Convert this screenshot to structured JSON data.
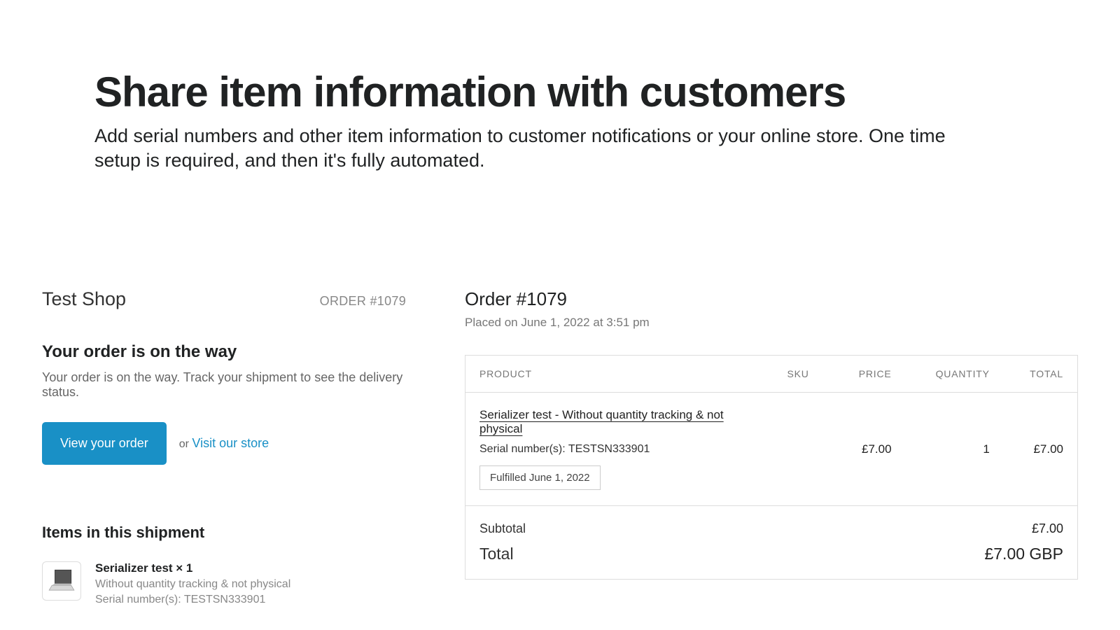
{
  "header": {
    "title": "Share item information with customers",
    "subtitle": "Add serial numbers and other item information to customer notifications or your online store. One time setup is required, and then it's fully automated."
  },
  "left": {
    "shop_name": "Test Shop",
    "order_number_label": "ORDER #1079",
    "status_heading": "Your order is on the way",
    "status_body": "Your order is on the way. Track your shipment to see the delivery status.",
    "cta_button": "View your order",
    "cta_or": "or ",
    "cta_link": "Visit our store",
    "items_heading": "Items in this shipment",
    "item": {
      "title": "Serializer test × 1",
      "sub1": "Without quantity tracking & not physical",
      "sub2": "Serial number(s): TESTSN333901"
    }
  },
  "right": {
    "order_title": "Order #1079",
    "placed": "Placed on June 1, 2022 at 3:51 pm",
    "cols": {
      "product": "PRODUCT",
      "sku": "SKU",
      "price": "PRICE",
      "quantity": "QUANTITY",
      "total": "TOTAL"
    },
    "row": {
      "name": "Serializer test - Without quantity tracking & not physical",
      "serial": "Serial number(s): TESTSN333901",
      "fulfilled": "Fulfilled June 1, 2022",
      "sku": "",
      "price": "£7.00",
      "qty": "1",
      "total": "£7.00"
    },
    "summary": {
      "subtotal_label": "Subtotal",
      "subtotal_value": "£7.00",
      "total_label": "Total",
      "total_value": "£7.00 GBP"
    }
  }
}
